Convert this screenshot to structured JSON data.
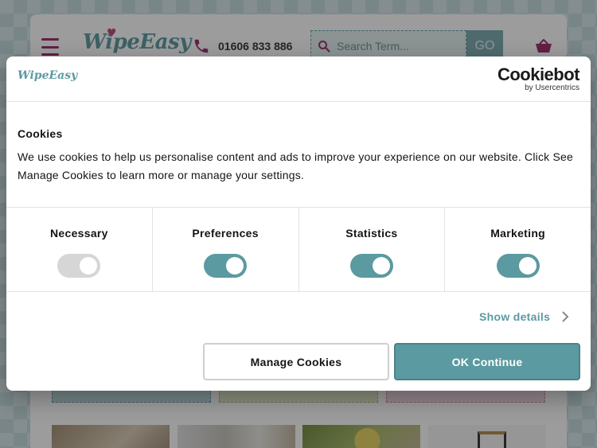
{
  "header": {
    "brand_logo": "WipeEasy",
    "phone_number": "01606 833 886",
    "search_placeholder": "Search Term...",
    "go_label": "GO"
  },
  "dialog": {
    "brand_logo": "WipeEasy",
    "cookiebot_name": "Cookiebot",
    "cookiebot_sub": "by Usercentrics",
    "title": "Cookies",
    "body": "We use cookies to help us personalise content and ads to improve your experience on our website. Click See Manage Cookies to learn more or manage your settings.",
    "toggles": [
      {
        "label": "Necessary",
        "state": "on-disabled"
      },
      {
        "label": "Preferences",
        "state": "on"
      },
      {
        "label": "Statistics",
        "state": "on"
      },
      {
        "label": "Marketing",
        "state": "on"
      }
    ],
    "show_details": "Show details",
    "manage_button": "Manage Cookies",
    "ok_button": "OK Continue"
  },
  "colors": {
    "accent": "#5b9aa0",
    "brand_pink": "#9c2a6d"
  }
}
